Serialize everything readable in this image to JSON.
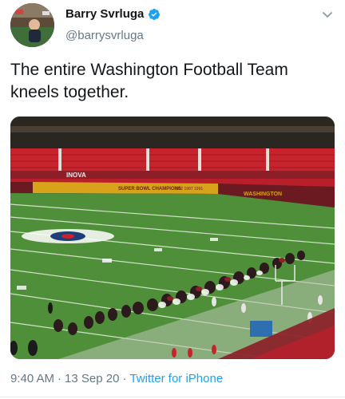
{
  "author": {
    "display_name": "Barry Svrluga",
    "handle": "@barrysvrluga",
    "verified": true
  },
  "tweet": {
    "text": "The entire Washington Football Team kneels together.",
    "time": "9:40 AM",
    "date": "13 Sep 20",
    "source": "Twitter for iPhone",
    "separator": "·"
  },
  "media": {
    "banner_text": "SUPER BOWL CHAMPIONS",
    "banner_years": "1982  1987  1991",
    "sideline_text": "WASHINGTON",
    "stands_text": "INOVA"
  },
  "colors": {
    "link": "#1da1f2",
    "secondary_text": "#657786",
    "verified": "#1da1f2",
    "seat_red": "#c8232c",
    "field_green": "#4f8f3a",
    "banner_gold": "#d9a21b",
    "banner_burgundy": "#6b1a22"
  },
  "icons": {
    "verified": "verified-badge-icon",
    "menu": "chevron-down-icon"
  }
}
